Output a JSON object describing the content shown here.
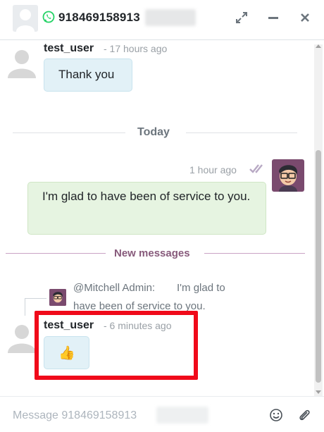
{
  "header": {
    "phone": "918469158913",
    "icons": {
      "whatsapp": "whatsapp-icon",
      "expand": "expand-icon",
      "minimize": "minimize-icon",
      "close": "close-icon"
    }
  },
  "messages": [
    {
      "author": "test_user",
      "time": "- 17 hours ago",
      "body": "Thank you"
    },
    {
      "time": "1 hour ago",
      "body": "I'm glad to have been of service to you."
    },
    {
      "author": "test_user",
      "time": "- 6 minutes ago",
      "body": "👍"
    }
  ],
  "date_separator": "Today",
  "new_messages_label": "New messages",
  "reply": {
    "author": "@Mitchell Admin:",
    "line1": "I'm glad to",
    "line2": "have been of service to you."
  },
  "composer": {
    "placeholder": "Message 918469158913",
    "icons": {
      "emoji": "emoji-icon",
      "attach": "paperclip-icon"
    }
  },
  "colors": {
    "accent": "#875a7b",
    "incoming_bubble": "#e2f1f7",
    "outgoing_bubble": "#e6f4e1",
    "whatsapp_green": "#25d366",
    "highlight": "#f00a1a"
  }
}
